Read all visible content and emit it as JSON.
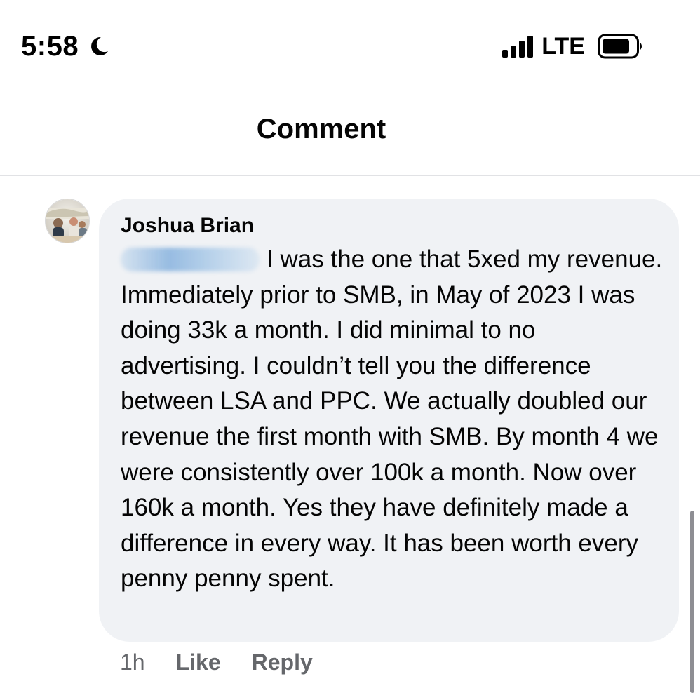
{
  "status_bar": {
    "time": "5:58",
    "network": "LTE"
  },
  "header": {
    "title": "Comment"
  },
  "comment": {
    "author": "Joshua Brian",
    "text": "I was the one that 5xed my revenue. Immediately prior to SMB, in May of 2023 I was doing 33k a month. I did minimal to no advertising. I couldn’t tell you the difference between LSA and PPC. We actually doubled our revenue the first month with SMB. By month 4 we were consistently over 100k a month. Now over 160k a month. Yes they have definitely made a difference in every way. It has been worth every penny penny spent.",
    "time_ago": "1h",
    "like_label": "Like",
    "reply_label": "Reply"
  },
  "colors": {
    "bubble_background": "#f0f2f5",
    "secondary_text": "#65676b",
    "primary_text": "#050505"
  }
}
